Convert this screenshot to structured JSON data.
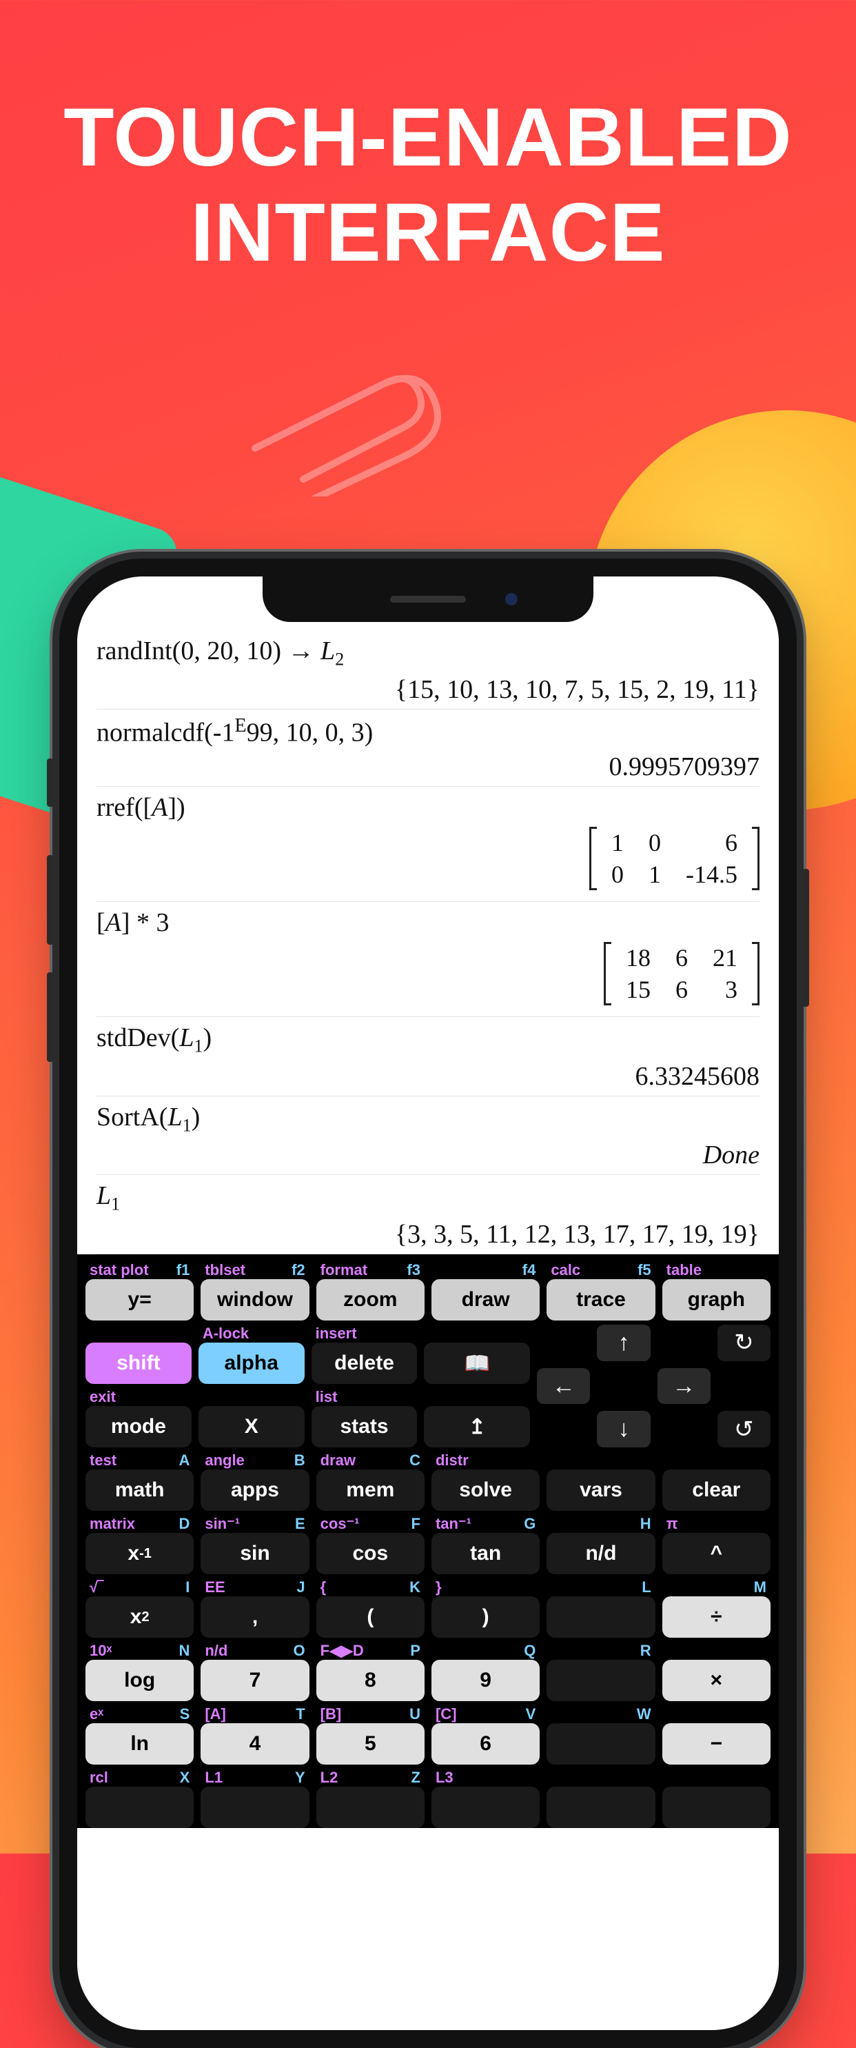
{
  "headline_line1": "TOUCH-ENABLED",
  "headline_line2": "INTERFACE",
  "history": [
    {
      "expr_html": "randInt(0, 20, 10) → <em>L</em><span class='sub'>2</span>",
      "res": "{15, 10, 13, 10, 7, 5, 15, 2, 19, 11}"
    },
    {
      "expr_html": "normalcdf(-1<span style='font-size:28px;vertical-align:super'>E</span>99, 10, 0, 3)",
      "res": "0.9995709397"
    },
    {
      "expr_html": "rref([<em>A</em>])",
      "matrix": [
        [
          "1",
          "0",
          "6"
        ],
        [
          "0",
          "1",
          "-14.5"
        ]
      ]
    },
    {
      "expr_html": "[<em>A</em>] * 3",
      "matrix": [
        [
          "18",
          "6",
          "21"
        ],
        [
          "15",
          "6",
          "3"
        ]
      ]
    },
    {
      "expr_html": "stdDev(<em>L</em><span class='sub'>1</span>)",
      "res": "6.33245608"
    },
    {
      "expr_html": "SortA(<em>L</em><span class='sub'>1</span>)",
      "res": "Done",
      "italic": true
    },
    {
      "expr_html": "<em>L</em><span class='sub'>1</span>",
      "res": "{3, 3, 5, 11, 12, 13, 17, 17, 19, 19}"
    }
  ],
  "toprow": [
    {
      "l1": "stat plot",
      "l2": "f1",
      "btn": "y="
    },
    {
      "l1": "tblset",
      "l2": "f2",
      "btn": "window"
    },
    {
      "l1": "format",
      "l2": "f3",
      "btn": "zoom"
    },
    {
      "l1": "",
      "l2": "f4",
      "btn": "draw"
    },
    {
      "l1": "calc",
      "l2": "f5",
      "btn": "trace"
    },
    {
      "l1": "table",
      "l2": "",
      "btn": "graph"
    }
  ],
  "row2a": [
    {
      "l1": "",
      "l2": "",
      "btn": "shift",
      "cls": "shift"
    },
    {
      "l1": "A-lock",
      "l2": "",
      "btn": "alpha",
      "cls": "alpha"
    },
    {
      "l1": "insert",
      "l2": "",
      "btn": "delete"
    },
    {
      "l1": "",
      "l2": "",
      "btn": "📖"
    }
  ],
  "row2b": [
    {
      "l1": "exit",
      "l2": "",
      "btn": "mode"
    },
    {
      "l1": "",
      "l2": "",
      "btn": "X"
    },
    {
      "l1": "list",
      "l2": "",
      "btn": "stats"
    },
    {
      "l1": "",
      "l2": "",
      "btn": "↥"
    }
  ],
  "row3": [
    {
      "l1": "test",
      "l2": "A",
      "btn": "math"
    },
    {
      "l1": "angle",
      "l2": "B",
      "btn": "apps"
    },
    {
      "l1": "draw",
      "l2": "C",
      "btn": "mem"
    },
    {
      "l1": "distr",
      "l2": "",
      "btn": "solve"
    },
    {
      "l1": "",
      "l2": "",
      "btn": "vars"
    },
    {
      "l1": "",
      "l2": "",
      "btn": "clear"
    }
  ],
  "row4": [
    {
      "l1": "matrix",
      "l2": "D",
      "btn_html": "x<span class='sup'>-1</span>"
    },
    {
      "l1": "sin⁻¹",
      "l2": "E",
      "btn": "sin"
    },
    {
      "l1": "cos⁻¹",
      "l2": "F",
      "btn": "cos"
    },
    {
      "l1": "tan⁻¹",
      "l2": "G",
      "btn": "tan"
    },
    {
      "l1": "",
      "l2": "H",
      "btn": "n/d"
    },
    {
      "l1": "π",
      "l2": "",
      "btn": "^"
    }
  ],
  "row5": [
    {
      "l1": "√‾",
      "l2": "I",
      "btn_html": "x<span class='sup'>2</span>"
    },
    {
      "l1": "EE",
      "l2": "J",
      "btn": ","
    },
    {
      "l1": "{",
      "l2": "K",
      "btn": "("
    },
    {
      "l1": "}",
      "l2": "",
      "btn": ")"
    },
    {
      "l1": "",
      "l2": "L",
      "btn": ""
    },
    {
      "l1": "",
      "l2": "M",
      "btn": "÷",
      "cls": "lgray"
    }
  ],
  "row6": [
    {
      "l1": "10ˣ",
      "l2": "N",
      "btn": "log",
      "cls": "lgray"
    },
    {
      "l1": "n/d",
      "l2": "O",
      "btn": "7",
      "cls": "lgray"
    },
    {
      "l1": "F◀▶D",
      "l2": "P",
      "btn": "8",
      "cls": "lgray"
    },
    {
      "l1": "",
      "l2": "Q",
      "btn": "9",
      "cls": "lgray"
    },
    {
      "l1": "",
      "l2": "R",
      "btn": "",
      "cls": ""
    },
    {
      "l1": "",
      "l2": "",
      "btn": "×",
      "cls": "lgray"
    }
  ],
  "row7": [
    {
      "l1": "eˣ",
      "l2": "S",
      "btn": "ln",
      "cls": "lgray"
    },
    {
      "l1": "[A]",
      "l2": "T",
      "btn": "4",
      "cls": "lgray"
    },
    {
      "l1": "[B]",
      "l2": "U",
      "btn": "5",
      "cls": "lgray"
    },
    {
      "l1": "[C]",
      "l2": "V",
      "btn": "6",
      "cls": "lgray"
    },
    {
      "l1": "",
      "l2": "W",
      "btn": "",
      "cls": ""
    },
    {
      "l1": "",
      "l2": "",
      "btn": "−",
      "cls": "lgray"
    }
  ],
  "row8": [
    {
      "l1": "rcl",
      "l2": "X",
      "btn": ""
    },
    {
      "l1": "L1",
      "l2": "Y",
      "btn": ""
    },
    {
      "l1": "L2",
      "l2": "Z",
      "btn": ""
    },
    {
      "l1": "L3",
      "l2": "",
      "btn": ""
    },
    {
      "l1": "",
      "l2": "",
      "btn": ""
    },
    {
      "l1": "",
      "l2": "",
      "btn": ""
    }
  ]
}
